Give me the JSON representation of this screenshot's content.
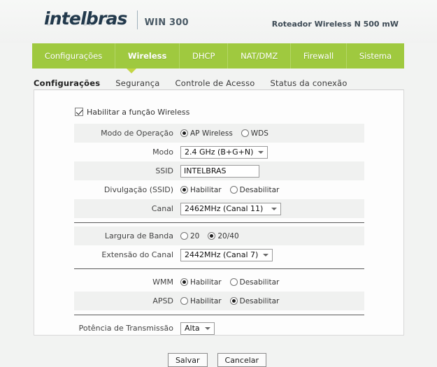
{
  "header": {
    "logo_text": "intelbras",
    "logo_model": "WIN 300",
    "product_title": "Roteador Wireless N 500 mW"
  },
  "mainnav": {
    "items": [
      {
        "label": "Configurações",
        "active": false
      },
      {
        "label": "Wireless",
        "active": true
      },
      {
        "label": "DHCP",
        "active": false
      },
      {
        "label": "NAT/DMZ",
        "active": false
      },
      {
        "label": "Firewall",
        "active": false
      },
      {
        "label": "Sistema",
        "active": false
      }
    ],
    "accent_color": "#9fc93f"
  },
  "subnav": {
    "items": [
      {
        "label": "Configurações",
        "active": true
      },
      {
        "label": "Segurança",
        "active": false
      },
      {
        "label": "Controle de Acesso",
        "active": false
      },
      {
        "label": "Status da conexão",
        "active": false
      }
    ]
  },
  "form": {
    "enable_wireless": {
      "label": "Habilitar a função Wireless",
      "checked": true
    },
    "modo_operacao": {
      "label": "Modo de Operação",
      "options": [
        {
          "label": "AP Wireless",
          "selected": true
        },
        {
          "label": "WDS",
          "selected": false
        }
      ]
    },
    "modo": {
      "label": "Modo",
      "value": "2.4 GHz (B+G+N)"
    },
    "ssid": {
      "label": "SSID",
      "value": "INTELBRAS",
      "placeholder": ""
    },
    "divulgacao_ssid": {
      "label": "Divulgação (SSID)",
      "options": [
        {
          "label": "Habilitar",
          "selected": true
        },
        {
          "label": "Desabilitar",
          "selected": false
        }
      ]
    },
    "canal": {
      "label": "Canal",
      "value": "2462MHz (Canal 11)"
    },
    "largura_banda": {
      "label": "Largura de Banda",
      "options": [
        {
          "label": "20",
          "selected": false
        },
        {
          "label": "20/40",
          "selected": true
        }
      ]
    },
    "extensao_canal": {
      "label": "Extensão do Canal",
      "value": "2442MHz (Canal 7)"
    },
    "wmm": {
      "label": "WMM",
      "options": [
        {
          "label": "Habilitar",
          "selected": true
        },
        {
          "label": "Desabilitar",
          "selected": false
        }
      ]
    },
    "apsd": {
      "label": "APSD",
      "options": [
        {
          "label": "Habilitar",
          "selected": false
        },
        {
          "label": "Desabilitar",
          "selected": true
        }
      ]
    },
    "potencia": {
      "label": "Potência de Transmissão",
      "value": "Alta"
    },
    "buttons": {
      "save": "Salvar",
      "cancel": "Cancelar"
    }
  }
}
